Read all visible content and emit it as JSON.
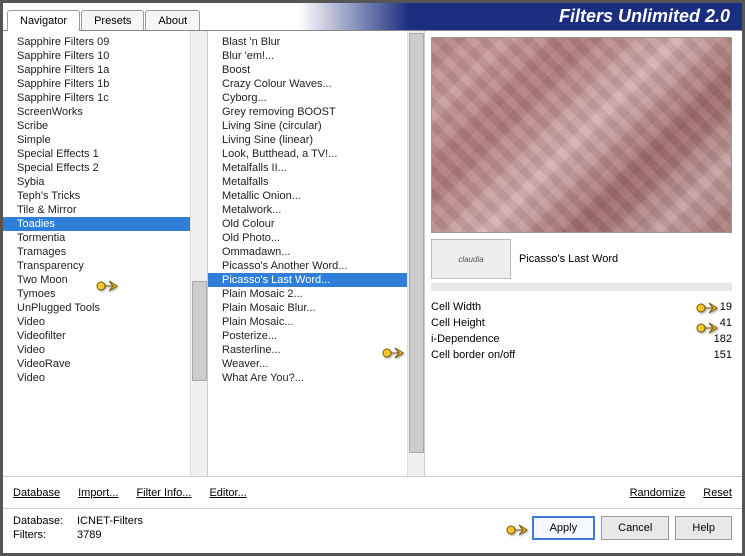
{
  "header": {
    "title": "Filters Unlimited 2.0",
    "tabs": [
      "Navigator",
      "Presets",
      "About"
    ],
    "active_tab": 0
  },
  "categories": [
    "Sapphire Filters 09",
    "Sapphire Filters 10",
    "Sapphire Filters 1a",
    "Sapphire Filters 1b",
    "Sapphire Filters 1c",
    "ScreenWorks",
    "Scribe",
    "Simple",
    "Special Effects 1",
    "Special Effects 2",
    "Sybia",
    "Teph's Tricks",
    "Tile & Mirror",
    "Toadies",
    "Tormentia",
    "Tramages",
    "Transparency",
    "Two Moon",
    "Tymoes",
    "UnPlugged Tools",
    "Video",
    "Videofilter",
    "Video",
    "VideoRave",
    "Video"
  ],
  "categories_selected": 13,
  "filters": [
    "Blast 'n Blur",
    "Blur 'em!...",
    "Boost",
    "Crazy Colour Waves...",
    "Cyborg...",
    "Grey removing BOOST",
    "Living Sine (circular)",
    "Living Sine (linear)",
    "Look, Butthead, a TV!...",
    "Metalfalls II...",
    "Metalfalls",
    "Metallic Onion...",
    "Metalwork...",
    "Old Colour",
    "Old Photo...",
    "Ommadawn...",
    "Picasso's Another Word...",
    "Picasso's Last Word...",
    "Plain Mosaic 2...",
    "Plain Mosaic Blur...",
    "Plain Mosaic...",
    "Posterize...",
    "Rasterline...",
    "Weaver...",
    "What Are You?..."
  ],
  "filters_selected": 17,
  "filter_name": "Picasso's Last Word",
  "watermark": "claudia",
  "params": [
    {
      "label": "Cell Width",
      "value": "19"
    },
    {
      "label": "Cell Height",
      "value": "41"
    },
    {
      "label": "i-Dependence",
      "value": "182"
    },
    {
      "label": "Cell border on/off",
      "value": "151"
    }
  ],
  "toolbar": {
    "database": "Database",
    "import": "Import...",
    "filter_info": "Filter Info...",
    "editor": "Editor...",
    "randomize": "Randomize",
    "reset": "Reset"
  },
  "footer": {
    "db_label": "Database:",
    "db_value": "ICNET-Filters",
    "filters_label": "Filters:",
    "filters_value": "3789",
    "apply": "Apply",
    "cancel": "Cancel",
    "help": "Help"
  }
}
